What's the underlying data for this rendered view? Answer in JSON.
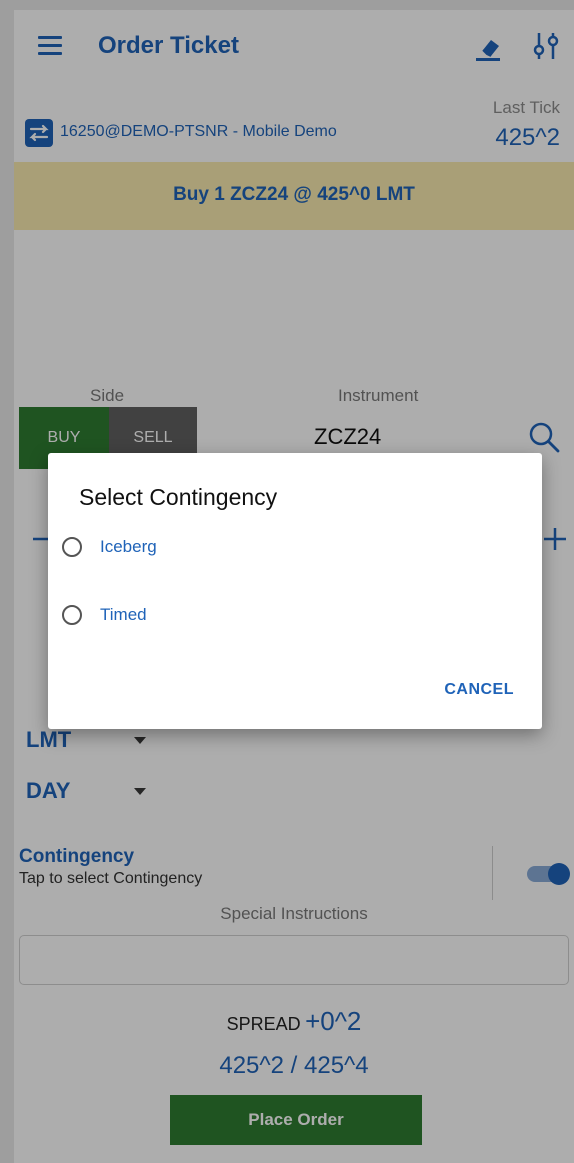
{
  "header": {
    "title": "Order Ticket",
    "eraser_icon": "eraser-icon",
    "settings_icon": "tune-icon"
  },
  "account": {
    "name": "16250@DEMO-PTSNR - Mobile Demo",
    "last_tick_label": "Last Tick",
    "last_tick_value": "425^2"
  },
  "summary": {
    "text": "Buy 1 ZCZ24 @ 425^0 LMT",
    "bg_color": "#f9ebb0"
  },
  "side": {
    "label": "Side",
    "buy_label": "BUY",
    "sell_label": "SELL",
    "selected": "BUY"
  },
  "instrument": {
    "label": "Instrument",
    "value": "ZCZ24"
  },
  "order_type": {
    "value": "LMT"
  },
  "duration": {
    "value": "DAY"
  },
  "contingency": {
    "title": "Contingency",
    "subtitle": "Tap to select Contingency",
    "toggle_on": true
  },
  "special_instructions": {
    "label": "Special Instructions",
    "value": ""
  },
  "spread": {
    "label": "SPREAD",
    "value": "+0^2"
  },
  "bid_ask": "425^2 / 425^4",
  "place_order_label": "Place Order",
  "dialog": {
    "title": "Select Contingency",
    "options": [
      {
        "label": "Iceberg",
        "selected": false
      },
      {
        "label": "Timed",
        "selected": false
      }
    ],
    "cancel_label": "CANCEL"
  },
  "colors": {
    "accent": "#1f63b8",
    "buy": "#2e7d32",
    "sell": "#616161"
  }
}
